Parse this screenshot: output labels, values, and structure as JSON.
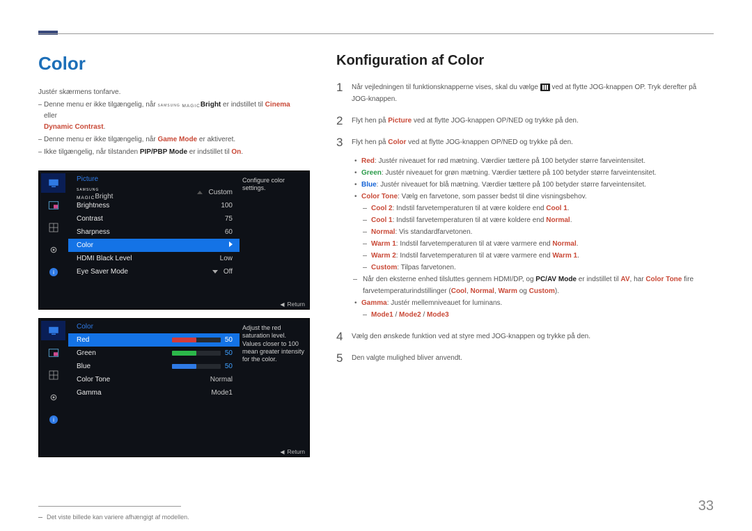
{
  "page_number": "33",
  "left": {
    "heading": "Color",
    "body": "Justér skærmens tonfarve.",
    "note1a": "Denne menu er ikke tilgængelig, når ",
    "note1_brand1": "SAMSUNG",
    "note1_brand2": "MAGIC",
    "note1b": "Bright",
    "note1c": " er indstillet til ",
    "note1_cinema": "Cinema",
    "note1d": " eller ",
    "note1_dc": "Dynamic Contrast",
    "note2a": "Denne menu er ikke tilgængelig, når ",
    "note2_gm": "Game Mode",
    "note2b": " er aktiveret.",
    "note3a": "Ikke tilgængelig, når tilstanden ",
    "note3_pip": "PIP/PBP Mode",
    "note3b": " er indstillet til ",
    "note3_on": "On",
    "footnote": "Det viste billede kan variere afhængigt af modellen."
  },
  "osd1": {
    "title": "Picture",
    "tip": "Configure color settings.",
    "rows": {
      "r0a": "Bright",
      "r0v": "Custom",
      "r1a": "Brightness",
      "r1v": "100",
      "r2a": "Contrast",
      "r2v": "75",
      "r3a": "Sharpness",
      "r3v": "60",
      "r4a": "Color",
      "r5a": "HDMI Black Level",
      "r5v": "Low",
      "r6a": "Eye Saver Mode",
      "r6v": "Off"
    },
    "return": "Return"
  },
  "osd2": {
    "title": "Color",
    "tip": "Adjust the red saturation level. Values closer to 100 mean greater intensity for the color.",
    "rows": {
      "r0a": "Red",
      "r0v": "50",
      "r1a": "Green",
      "r1v": "50",
      "r2a": "Blue",
      "r2v": "50",
      "r3a": "Color Tone",
      "r3v": "Normal",
      "r4a": "Gamma",
      "r4v": "Mode1"
    },
    "return": "Return"
  },
  "right": {
    "heading": "Konfiguration af Color",
    "steps": {
      "s1a": "Når vejledningen til funktionsknapperne vises, skal du vælge ",
      "s1b": " ved at flytte JOG-knappen OP. Tryk derefter på JOG-knappen.",
      "s2a": "Flyt hen på ",
      "s2_pic": "Picture",
      "s2b": " ved at flytte JOG-knappen OP/NED og trykke på den.",
      "s3a": "Flyt hen på ",
      "s3_col": "Color",
      "s3b": " ved at flytte JOG-knappen OP/NED og trykke på den.",
      "s4": "Vælg den ønskede funktion ved at styre med JOG-knappen og trykke på den.",
      "s5": "Den valgte mulighed bliver anvendt."
    },
    "bullets": {
      "red": "Red",
      "red_t": ": Justér niveauet for rød mætning. Værdier tættere på 100 betyder større farveintensitet.",
      "green": "Green",
      "green_t": ": Justér niveauet for grøn mætning. Værdier tættere på 100 betyder større farveintensitet.",
      "blue": "Blue",
      "blue_t": ": Justér niveauet for blå mætning. Værdier tættere på 100 betyder større farveintensitet.",
      "colortone": "Color Tone",
      "colortone_t": ": Vælg en farvetone, som passer bedst til dine visningsbehov.",
      "cool2": "Cool 2",
      "cool2_t": ": Indstil farvetemperaturen til at være koldere end ",
      "cool1_ref": "Cool 1",
      "cool1": "Cool 1",
      "cool1_t": ": Indstil farvetemperaturen til at være koldere end ",
      "normal_ref": "Normal",
      "normal": "Normal",
      "normal_t": ": Vis standardfarvetonen.",
      "warm1": "Warm 1",
      "warm1_t": ": Indstil farvetemperaturen til at være varmere end ",
      "warm2": "Warm 2",
      "warm2_t": ": Indstil farvetemperaturen til at være varmere end ",
      "warm1_ref": "Warm 1",
      "custom": "Custom",
      "custom_t": ": Tilpas farvetonen.",
      "footnote_a": "Når den eksterne enhed tilsluttes gennem HDMI/DP, og ",
      "pcav": "PC/AV Mode",
      "footnote_b": " er indstillet til ",
      "av": "AV",
      "footnote_c": ", har ",
      "ct": "Color Tone",
      "footnote_d": " fire farvetemperaturindstillinger (",
      "coolw": "Cool",
      "c1": ", ",
      "normalw": "Normal",
      "c2": ", ",
      "warmw": "Warm",
      "c3": " og ",
      "customw": "Custom",
      "c4": ").",
      "gamma": "Gamma",
      "gamma_t": ": Justér mellemniveauet for luminans.",
      "modes": "Mode1",
      "slash": " / ",
      "mode2": "Mode2",
      "mode3": "Mode3"
    }
  }
}
